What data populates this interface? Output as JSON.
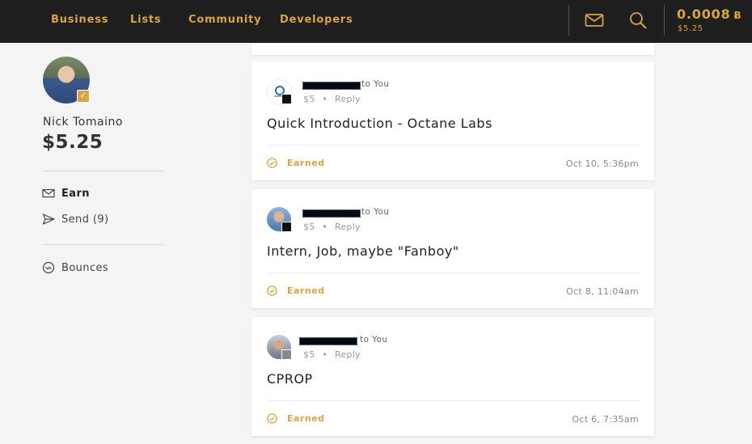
{
  "nav": {
    "links": [
      "Business",
      "Lists",
      "Community",
      "Developers"
    ],
    "balance_btc": "0.0008",
    "btc_symbol": "Ƀ",
    "balance_usd": "$5.25",
    "accent": "#d9a441"
  },
  "profile": {
    "name": "Nick Tomaino",
    "balance": "$5.25"
  },
  "sidebar": {
    "items": [
      {
        "label": "Earn",
        "icon": "mail-icon"
      },
      {
        "label": "Send (9)",
        "icon": "send-icon"
      },
      {
        "label": "Bounces",
        "icon": "bounce-icon"
      }
    ]
  },
  "feed": [
    {
      "recipient": "to You",
      "amount": "$5",
      "reply": "Reply",
      "title": "Quick Introduction - Octane Labs",
      "status": "Earned",
      "date": "Oct 10, 5:36pm"
    },
    {
      "recipient": "to You",
      "amount": "$5",
      "reply": "Reply",
      "title": "Intern, Job, maybe \"Fanboy\"",
      "status": "Earned",
      "date": "Oct 8, 11:04am"
    },
    {
      "recipient": "to You",
      "amount": "$5",
      "reply": "Reply",
      "title": "CPROP",
      "status": "Earned",
      "date": "Oct 6, 7:35am"
    }
  ],
  "meta_separator": "•"
}
